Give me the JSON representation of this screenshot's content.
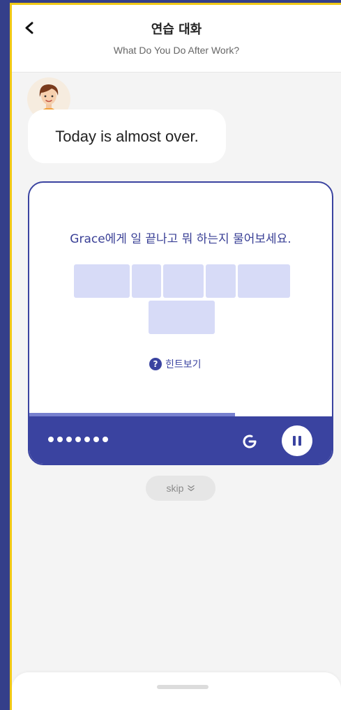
{
  "header": {
    "title": "연습 대화",
    "subtitle": "What Do You Do After Work?",
    "back_icon": "chevron-left-icon"
  },
  "chat": {
    "speaker_icon": "woman-avatar-icon",
    "message": "Today is almost over."
  },
  "exercise": {
    "prompt": "Grace에게 일 끝나고 뭐 하는지 물어보세요.",
    "answer_slots": 6,
    "hint_label": "힌트보기",
    "hint_icon": "question-circle-icon",
    "progress_percent": 68,
    "dots_count": 7,
    "replay_icon": "replay-icon",
    "pause_icon": "pause-icon",
    "accent_color": "#3a43a0",
    "slot_color": "#d7dbf7"
  },
  "skip": {
    "label": "skip",
    "icon": "double-chevron-down-icon"
  },
  "bottom_sheet": {
    "handle": "drag-handle"
  }
}
